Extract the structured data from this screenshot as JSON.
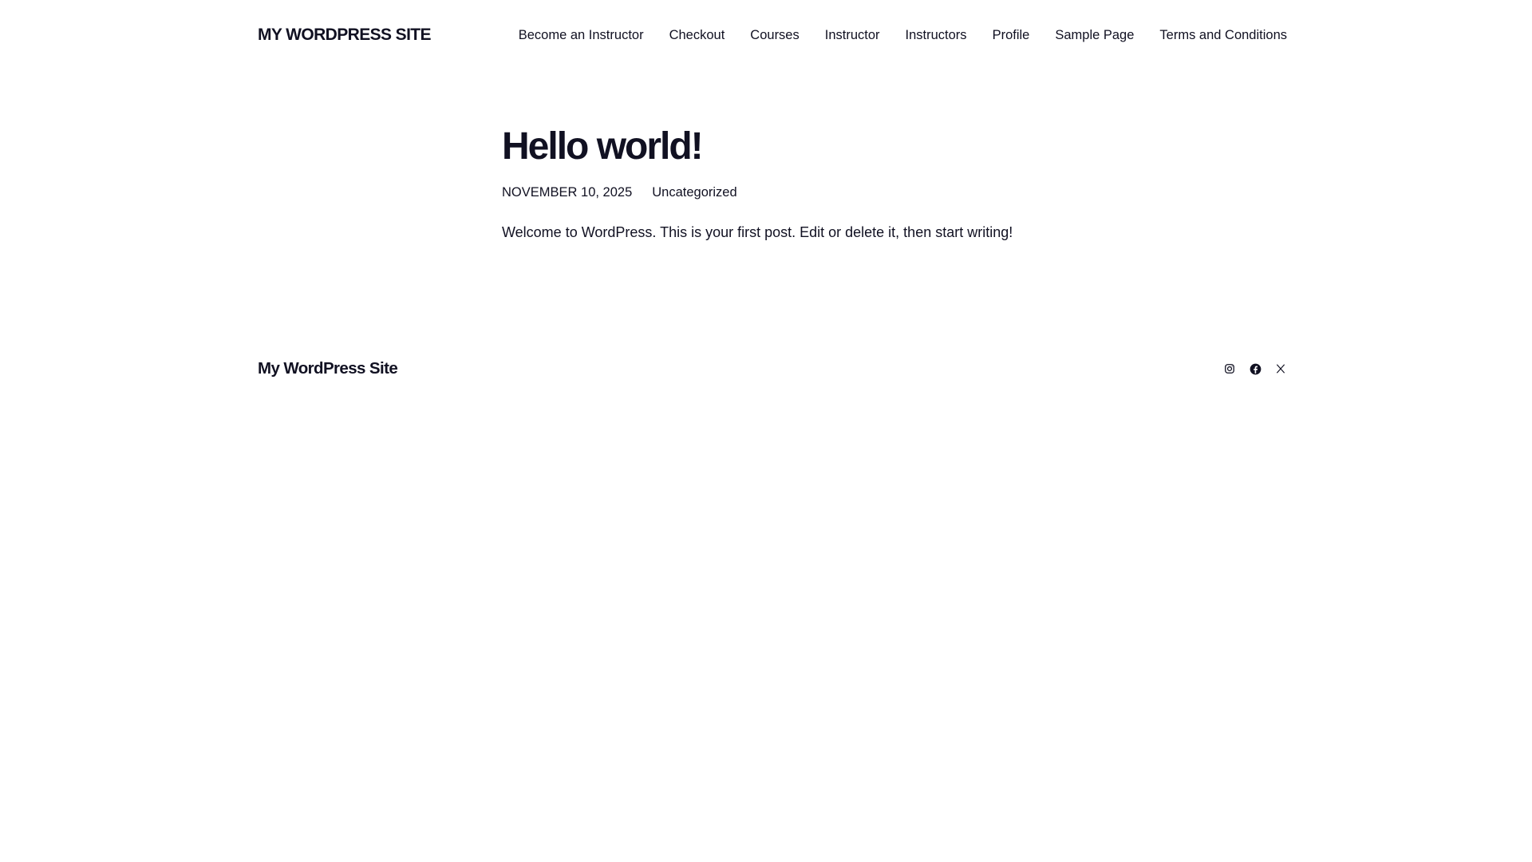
{
  "header": {
    "site_title": "MY WORDPRESS SITE",
    "nav": [
      {
        "label": "Become an Instructor"
      },
      {
        "label": "Checkout"
      },
      {
        "label": "Courses"
      },
      {
        "label": "Instructor"
      },
      {
        "label": "Instructors"
      },
      {
        "label": "Profile"
      },
      {
        "label": "Sample Page"
      },
      {
        "label": "Terms and Conditions"
      }
    ]
  },
  "post": {
    "title": "Hello world!",
    "date": "NOVEMBER 10, 2025",
    "category": "Uncategorized",
    "content": "Welcome to WordPress. This is your first post. Edit or delete it, then start writing!"
  },
  "footer": {
    "site_title": "My WordPress Site",
    "social": [
      {
        "icon": "instagram-icon"
      },
      {
        "icon": "facebook-icon"
      },
      {
        "icon": "x-icon"
      }
    ]
  },
  "colors": {
    "text": "#111122",
    "background": "#ffffff"
  }
}
